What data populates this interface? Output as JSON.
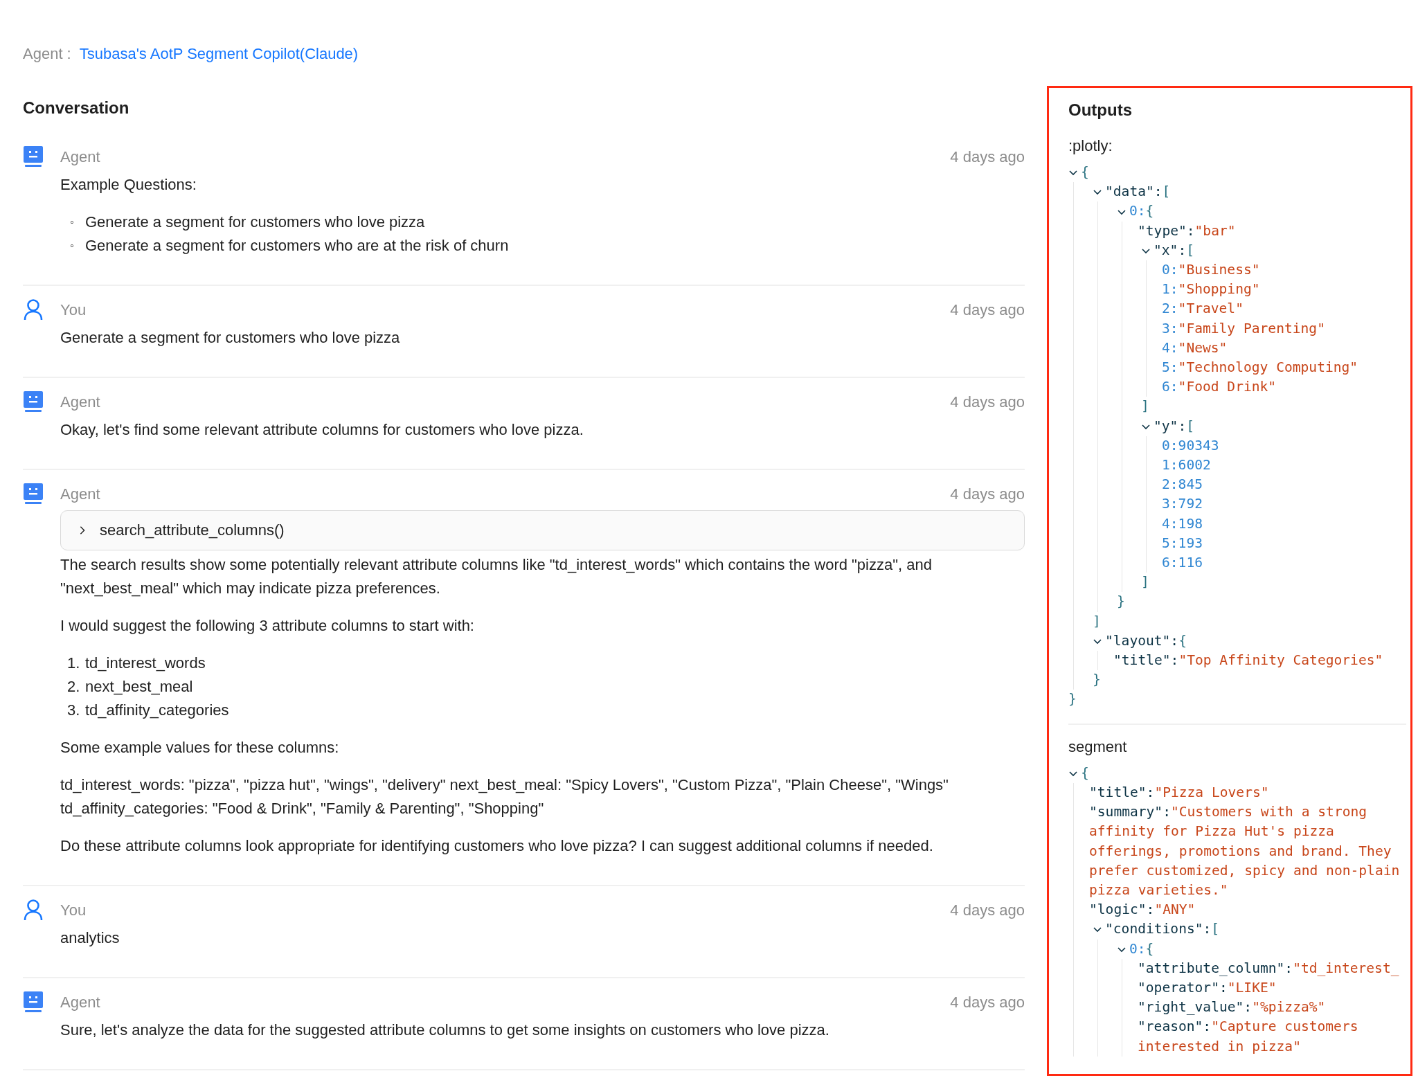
{
  "agent_bar": {
    "label": "Agent :",
    "name": "Tsubasa's AotP Segment Copilot(Claude)"
  },
  "conversation": {
    "title": "Conversation",
    "messages": [
      {
        "kind": "agent",
        "author": "Agent",
        "time": "4 days ago",
        "blocks": [
          {
            "kind": "paragraph",
            "text": "Example Questions:"
          },
          {
            "kind": "bullets",
            "items": [
              {
                "marker": "◦",
                "text": "Generate a segment for customers who love pizza"
              },
              {
                "marker": "◦",
                "text": "Generate a segment for customers who are at the risk of churn"
              }
            ]
          }
        ]
      },
      {
        "kind": "user",
        "author": "You",
        "time": "4 days ago",
        "blocks": [
          {
            "kind": "paragraph",
            "text": "Generate a segment for customers who love pizza"
          }
        ]
      },
      {
        "kind": "agent",
        "author": "Agent",
        "time": "4 days ago",
        "blocks": [
          {
            "kind": "paragraph",
            "text": "Okay, let's find some relevant attribute columns for customers who love pizza."
          }
        ]
      },
      {
        "kind": "agent",
        "author": "Agent",
        "time": "4 days ago",
        "blocks": [
          {
            "kind": "tool",
            "label": "search_attribute_columns()",
            "expanded": false
          },
          {
            "kind": "paragraph",
            "text": "The search results show some potentially relevant attribute columns like \"td_interest_words\" which contains the word \"pizza\", and \"next_best_meal\" which may indicate pizza preferences."
          },
          {
            "kind": "paragraph",
            "text": "I would suggest the following 3 attribute columns to start with:"
          },
          {
            "kind": "numbered",
            "items": [
              {
                "marker": "1.",
                "text": "td_interest_words"
              },
              {
                "marker": "2.",
                "text": "next_best_meal"
              },
              {
                "marker": "3.",
                "text": "td_affinity_categories"
              }
            ]
          },
          {
            "kind": "paragraph",
            "text": "Some example values for these columns:"
          },
          {
            "kind": "paragraph",
            "text": "td_interest_words: \"pizza\", \"pizza hut\", \"wings\", \"delivery\" next_best_meal: \"Spicy Lovers\", \"Custom Pizza\", \"Plain Cheese\", \"Wings\" td_affinity_categories: \"Food & Drink\", \"Family & Parenting\", \"Shopping\""
          },
          {
            "kind": "paragraph",
            "text": "Do these attribute columns look appropriate for identifying customers who love pizza? I can suggest additional columns if needed."
          }
        ]
      },
      {
        "kind": "user",
        "author": "You",
        "time": "4 days ago",
        "blocks": [
          {
            "kind": "paragraph",
            "text": "analytics"
          }
        ]
      },
      {
        "kind": "agent",
        "author": "Agent",
        "time": "4 days ago",
        "blocks": [
          {
            "kind": "paragraph",
            "text": "Sure, let's analyze the data for the suggested attribute columns to get some insights on customers who love pizza."
          }
        ]
      }
    ]
  },
  "outputs": {
    "title": "Outputs",
    "highlighted": true,
    "sections": [
      {
        "label": ":plotly:",
        "tree": {
          "open": "{",
          "expanded": true,
          "close": "}",
          "children": [
            {
              "kind": "name-branch",
              "key": "\"data\":",
              "open": "[",
              "expanded": true,
              "close": "]",
              "children": [
                {
                  "kind": "index-branch",
                  "key": "0:",
                  "open": "{",
                  "expanded": true,
                  "close": "}",
                  "children": [
                    {
                      "kind": "name-string",
                      "key": "\"type\":",
                      "value": "\"bar\""
                    },
                    {
                      "kind": "name-branch",
                      "key": "\"x\":",
                      "open": "[",
                      "expanded": true,
                      "close": "]",
                      "children": [
                        {
                          "kind": "index-string",
                          "key": "0:",
                          "value": "\"Business\""
                        },
                        {
                          "kind": "index-string",
                          "key": "1:",
                          "value": "\"Shopping\""
                        },
                        {
                          "kind": "index-string",
                          "key": "2:",
                          "value": "\"Travel\""
                        },
                        {
                          "kind": "index-string",
                          "key": "3:",
                          "value": "\"Family Parenting\""
                        },
                        {
                          "kind": "index-string",
                          "key": "4:",
                          "value": "\"News\""
                        },
                        {
                          "kind": "index-string",
                          "key": "5:",
                          "value": "\"Technology Computing\""
                        },
                        {
                          "kind": "index-string",
                          "key": "6:",
                          "value": "\"Food Drink\""
                        }
                      ]
                    },
                    {
                      "kind": "name-branch",
                      "key": "\"y\":",
                      "open": "[",
                      "expanded": true,
                      "close": "]",
                      "children": [
                        {
                          "kind": "index-number",
                          "key": "0:",
                          "value": "90343"
                        },
                        {
                          "kind": "index-number",
                          "key": "1:",
                          "value": "6002"
                        },
                        {
                          "kind": "index-number",
                          "key": "2:",
                          "value": "845"
                        },
                        {
                          "kind": "index-number",
                          "key": "3:",
                          "value": "792"
                        },
                        {
                          "kind": "index-number",
                          "key": "4:",
                          "value": "198"
                        },
                        {
                          "kind": "index-number",
                          "key": "5:",
                          "value": "193"
                        },
                        {
                          "kind": "index-number",
                          "key": "6:",
                          "value": "116"
                        }
                      ]
                    }
                  ]
                }
              ]
            },
            {
              "kind": "name-branch",
              "key": "\"layout\":",
              "open": "{",
              "expanded": true,
              "close": "}",
              "children": [
                {
                  "kind": "name-string",
                  "key": "\"title\":",
                  "value": "\"Top Affinity Categories\""
                }
              ]
            }
          ]
        }
      },
      {
        "label": "segment",
        "tree": {
          "open": "{",
          "expanded": true,
          "children": [
            {
              "kind": "name-string",
              "key": "\"title\":",
              "value": "\"Pizza Lovers\""
            },
            {
              "kind": "name-string",
              "key": "\"summary\":",
              "value": "\"Customers with a strong affinity for Pizza Hut's pizza offerings, promotions and brand. They prefer customized, spicy and non-plain pizza varieties.\""
            },
            {
              "kind": "name-string",
              "key": "\"logic\":",
              "value": "\"ANY\""
            },
            {
              "kind": "name-branch",
              "key": "\"conditions\":",
              "open": "[",
              "expanded": true,
              "children": [
                {
                  "kind": "index-branch",
                  "key": "0:",
                  "open": "{",
                  "expanded": true,
                  "children": [
                    {
                      "kind": "name-string",
                      "key": "\"attribute_column\":",
                      "value": "\"td_interest_"
                    },
                    {
                      "kind": "name-string",
                      "key": "\"operator\":",
                      "value": "\"LIKE\""
                    },
                    {
                      "kind": "name-string",
                      "key": "\"right_value\":",
                      "value": "\"%pizza%\""
                    },
                    {
                      "kind": "name-string",
                      "key": "\"reason\":",
                      "value": "\"Capture customers interested in pizza\""
                    }
                  ]
                }
              ]
            }
          ]
        }
      }
    ]
  }
}
